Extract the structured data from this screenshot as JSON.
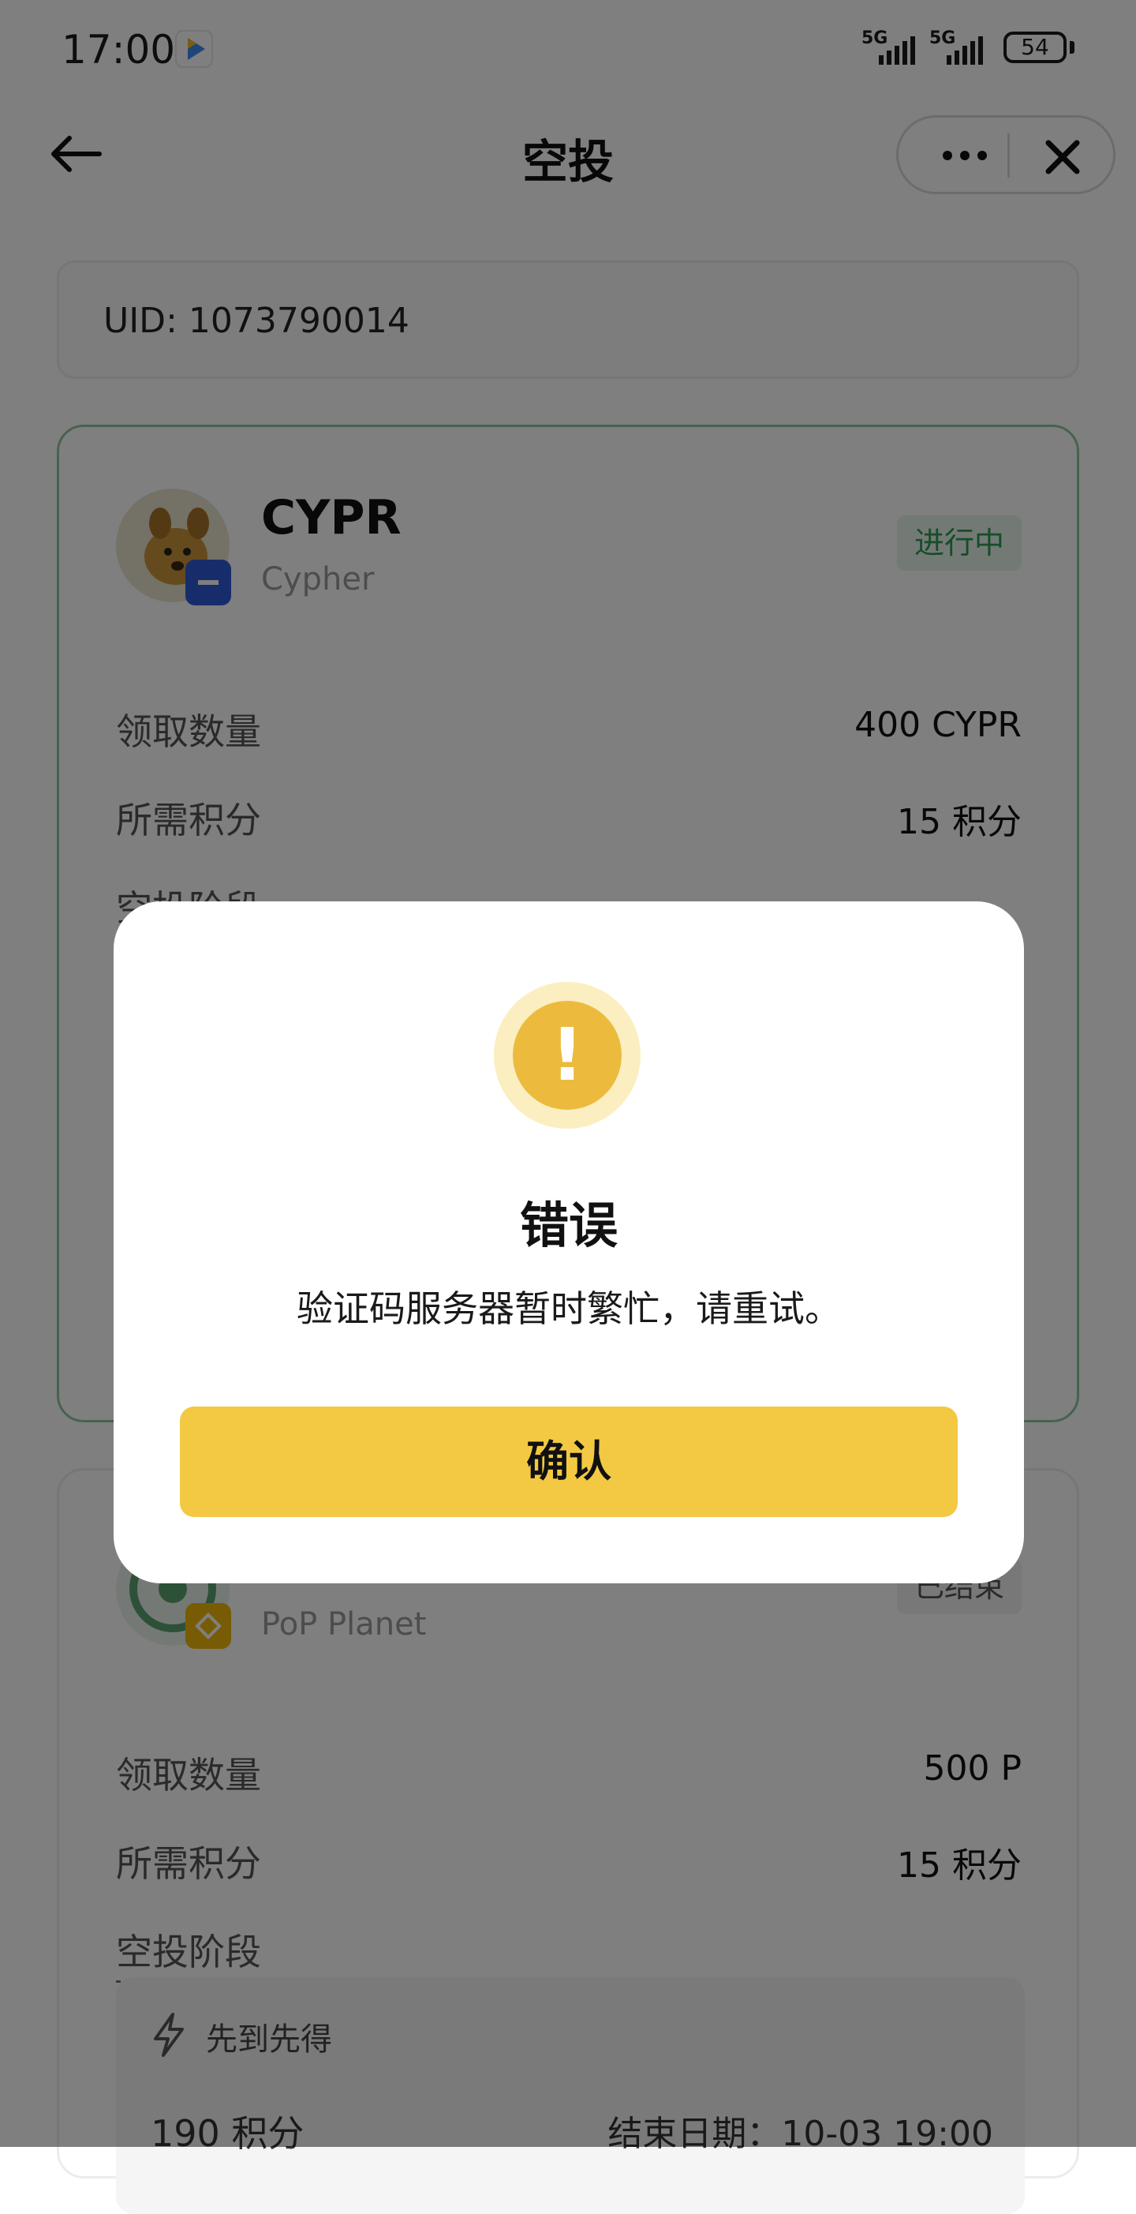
{
  "status_bar": {
    "time": "17:00",
    "network_1": "5G",
    "network_2": "5G",
    "battery": "54"
  },
  "nav": {
    "title": "空投"
  },
  "account": {
    "uid_text": "UID: 1073790014"
  },
  "airdrops": [
    {
      "symbol": "CYPR",
      "name": "Cypher",
      "status": "进行中",
      "receive_label": "领取数量",
      "receive_value": "400 CYPR",
      "points_label": "所需积分",
      "points_value": "15 积分",
      "stage_label": "空投阶段"
    },
    {
      "symbol": "",
      "name": "PoP Planet",
      "status": "已结束",
      "receive_label": "领取数量",
      "receive_value": "500 P",
      "points_label": "所需积分",
      "points_value": "15 积分",
      "stage_label": "空投阶段",
      "phase": {
        "title": "先到先得",
        "points": "190 积分",
        "end_date": "结束日期：10-03 19:00"
      }
    }
  ],
  "dialog": {
    "title": "错误",
    "message": "验证码服务器暂时繁忙，请重试。",
    "confirm_label": "确认",
    "icon": "warning-icon"
  },
  "colors": {
    "accent_yellow": "#f3c943",
    "warning_icon": "#ecbb3e",
    "live_green": "#2f9a52"
  }
}
